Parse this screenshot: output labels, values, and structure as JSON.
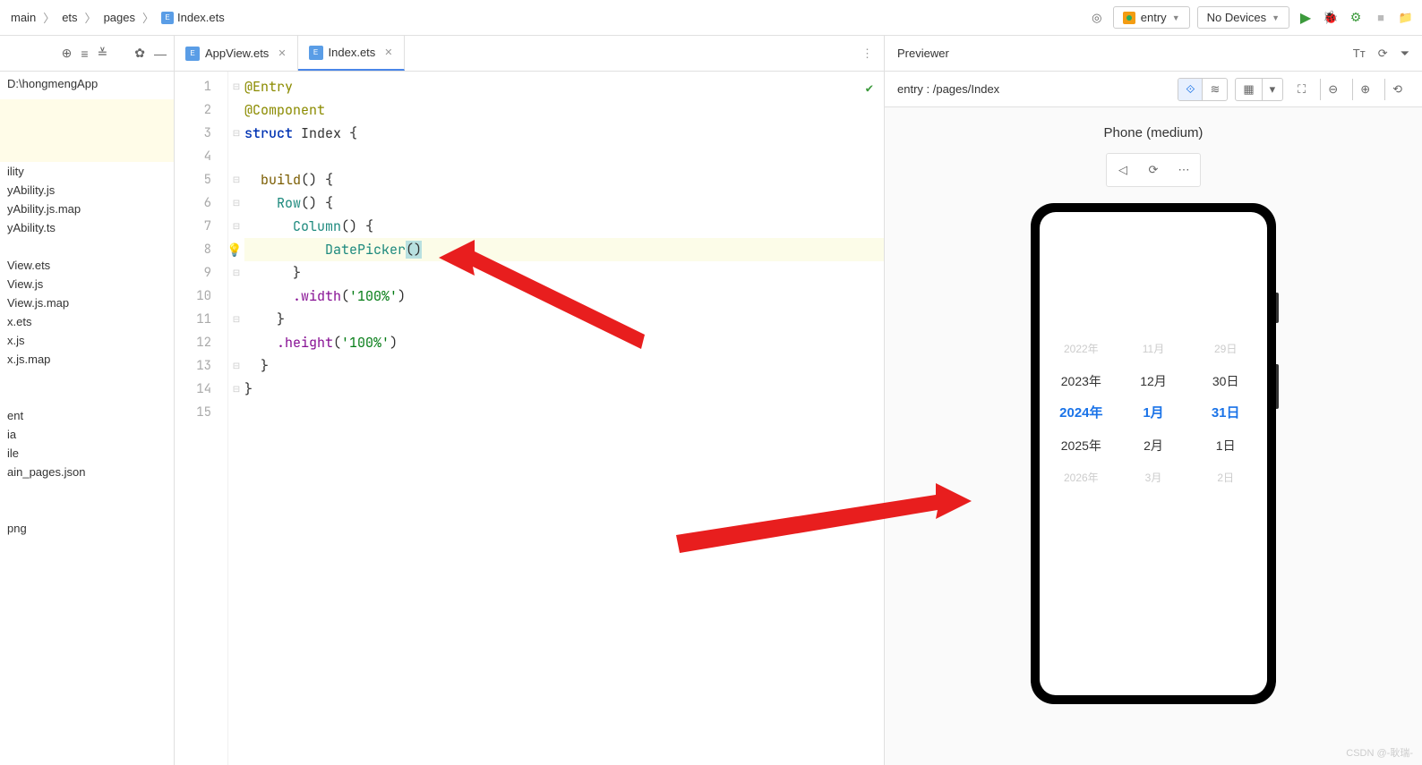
{
  "breadcrumbs": [
    "main",
    "ets",
    "pages",
    "Index.ets"
  ],
  "topRight": {
    "entry": "entry",
    "devices": "No Devices"
  },
  "tabs": [
    {
      "label": "AppView.ets",
      "active": false
    },
    {
      "label": "Index.ets",
      "active": true
    }
  ],
  "projectPath": "D:\\hongmengApp",
  "tree": [
    "ility",
    "yAbility.js",
    "yAbility.js.map",
    "yAbility.ts",
    "",
    "View.ets",
    "View.js",
    "View.js.map",
    "x.ets",
    "x.js",
    "x.js.map",
    "",
    "",
    "ent",
    "ia",
    "ile",
    "ain_pages.json",
    "",
    "",
    "png"
  ],
  "lineNumbers": [
    "1",
    "2",
    "3",
    "4",
    "5",
    "6",
    "7",
    "8",
    "9",
    "10",
    "11",
    "12",
    "13",
    "14",
    "15"
  ],
  "code": {
    "l1": "@Entry",
    "l2": "@Component",
    "kwStruct": "struct",
    "idxName": " Index ",
    "brace": "{",
    "braceClose": "}",
    "build": "build",
    "row": "Row",
    "column": "Column",
    "datepicker": "DatePicker",
    "paren": "()",
    "parenSp": "() ",
    "width": ".width",
    "height": ".height",
    "wVal": "'100%'",
    "hVal": "'100%'"
  },
  "previewer": {
    "title": "Previewer",
    "path": "entry : /pages/Index",
    "deviceLabel": "Phone (medium)"
  },
  "datePicker": {
    "years": [
      "2022年",
      "2023年",
      "2024年",
      "2025年",
      "2026年"
    ],
    "months": [
      "11月",
      "12月",
      "1月",
      "2月",
      "3月"
    ],
    "days": [
      "29日",
      "30日",
      "31日",
      "1日",
      "2日"
    ]
  },
  "watermark": "CSDN @-耿瑞-"
}
